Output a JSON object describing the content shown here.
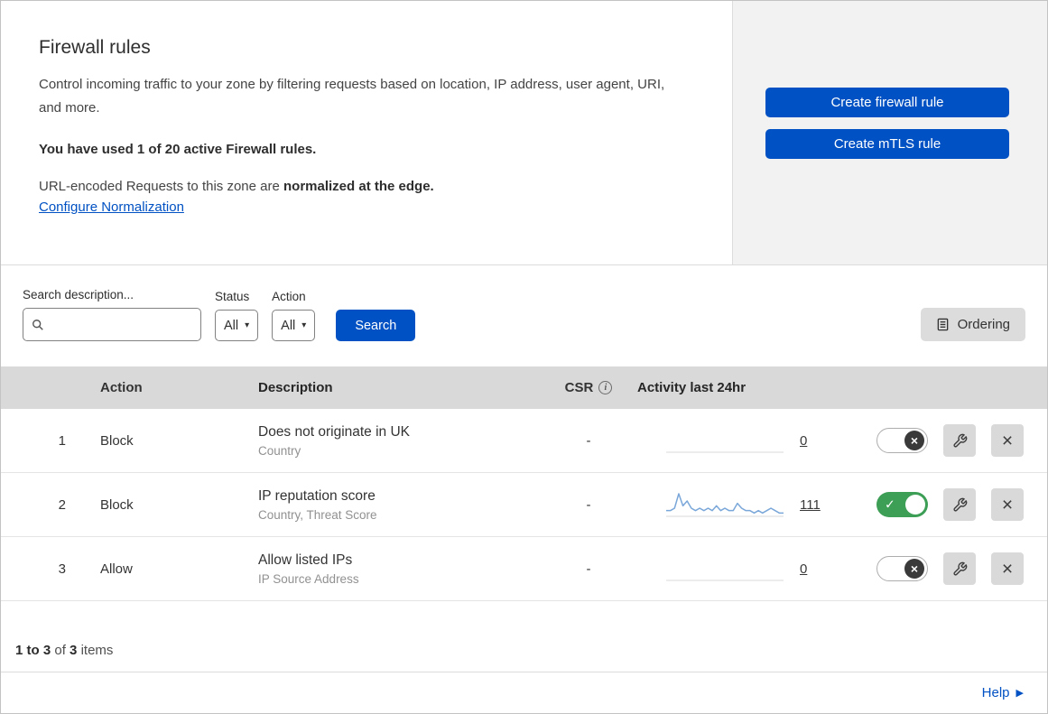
{
  "colors": {
    "accent_blue": "#0051c3",
    "toggle_green": "#3d9e55",
    "sparkline_blue": "#7aa7d9",
    "header_gray": "#d9d9d9"
  },
  "icons": {
    "caret_down": "▾",
    "check": "✓",
    "cross": "×",
    "close": "×",
    "info": "i",
    "help_arrow": "▶"
  },
  "intro": {
    "title": "Firewall rules",
    "description": "Control incoming traffic to your zone by filtering requests based on location, IP address, user agent, URI, and more.",
    "usage_note": "You have used 1 of 20 active Firewall rules.",
    "normalization_text": "URL-encoded Requests to this zone are ",
    "normalization_bold": "normalized at the edge.",
    "normalization_link": "Configure Normalization"
  },
  "actions": {
    "create_firewall_rule": "Create firewall rule",
    "create_mtls_rule": "Create mTLS rule"
  },
  "filters": {
    "search_label": "Search description...",
    "status_label": "Status",
    "status_value": "All",
    "action_label": "Action",
    "action_value": "All",
    "search_button": "Search",
    "ordering_button": "Ordering"
  },
  "table": {
    "headers": {
      "action": "Action",
      "description": "Description",
      "csr": "CSR",
      "activity": "Activity last 24hr"
    },
    "rows": [
      {
        "index": "1",
        "action": "Block",
        "description": "Does not originate in UK",
        "criteria": "Country",
        "csr": "-",
        "activity_count": "0",
        "enabled": false,
        "sparkline": []
      },
      {
        "index": "2",
        "action": "Block",
        "description": "IP reputation score",
        "criteria": "Country, Threat Score",
        "csr": "-",
        "activity_count": "111",
        "enabled": true,
        "sparkline": [
          2,
          2,
          3,
          9,
          4,
          6,
          3,
          2,
          3,
          2,
          3,
          2,
          4,
          2,
          3,
          2,
          2,
          5,
          3,
          2,
          2,
          1,
          2,
          1,
          2,
          3,
          2,
          1,
          1
        ]
      },
      {
        "index": "3",
        "action": "Allow",
        "description": "Allow listed IPs",
        "criteria": "IP Source Address",
        "csr": "-",
        "activity_count": "0",
        "enabled": false,
        "sparkline": []
      }
    ]
  },
  "footer": {
    "range": "1 to 3",
    "of": "of",
    "total": "3",
    "items": "items"
  },
  "help": {
    "label": "Help"
  }
}
